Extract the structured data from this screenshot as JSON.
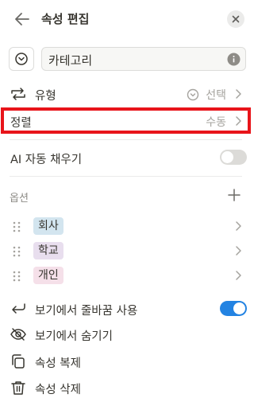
{
  "header": {
    "title": "속성 편집"
  },
  "name_field": {
    "value": "카테고리"
  },
  "rows": {
    "type": {
      "label": "유형",
      "value": "선택"
    },
    "sort": {
      "label": "정렬",
      "value": "수동"
    },
    "ai": {
      "label": "AI 자동 채우기",
      "enabled": false
    }
  },
  "options": {
    "header": "옵션",
    "items": [
      {
        "label": "회사",
        "color": "#d3e5ef"
      },
      {
        "label": "학교",
        "color": "#e8deee"
      },
      {
        "label": "개인",
        "color": "#f5e0e9"
      }
    ]
  },
  "actions": {
    "wrap": {
      "label": "보기에서 줄바꿈 사용",
      "enabled": true
    },
    "hide": {
      "label": "보기에서 숨기기"
    },
    "duplicate": {
      "label": "속성 복제"
    },
    "delete": {
      "label": "속성 삭제"
    }
  },
  "colors": {
    "accent": "#2383e2",
    "highlight": "#e8141a"
  }
}
